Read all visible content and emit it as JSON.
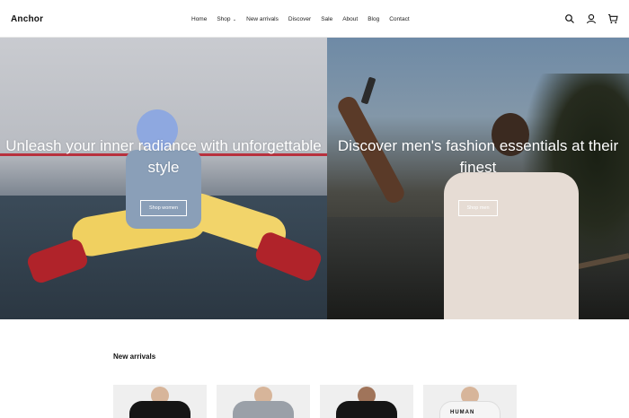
{
  "brand": {
    "logo": "Anchor"
  },
  "nav": {
    "items": [
      {
        "label": "Home"
      },
      {
        "label": "Shop"
      },
      {
        "label": "New arrivals"
      },
      {
        "label": "Discover"
      },
      {
        "label": "Sale"
      },
      {
        "label": "About"
      },
      {
        "label": "Blog"
      },
      {
        "label": "Contact"
      }
    ]
  },
  "header_icons": [
    "search-icon",
    "user-icon",
    "cart-icon"
  ],
  "hero": {
    "left": {
      "title": "Unleash your inner radiance with unforgettable style",
      "button": "Shop women"
    },
    "right": {
      "title": "Discover men's fashion essentials at their finest",
      "button": "Shop men"
    }
  },
  "new_arrivals": {
    "title": "New arrivals",
    "products": [
      {
        "print": ""
      },
      {
        "print": ""
      },
      {
        "print": ""
      },
      {
        "print": "HUMAN"
      }
    ]
  }
}
